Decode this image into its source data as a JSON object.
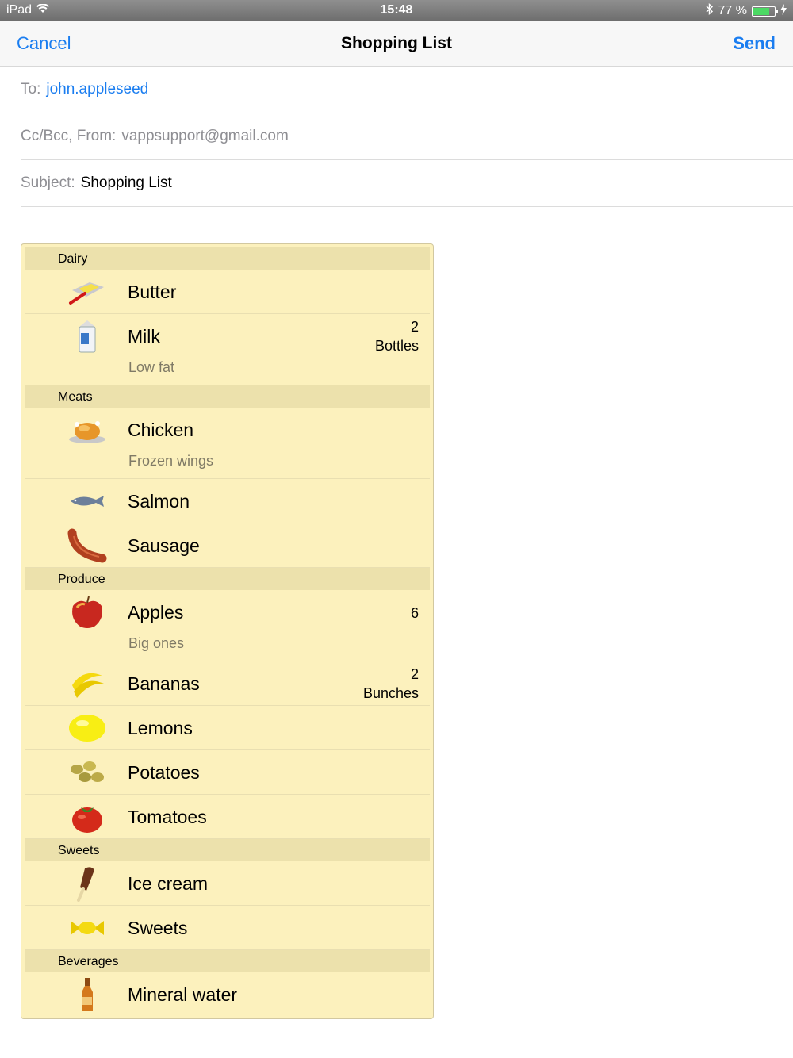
{
  "status_bar": {
    "device": "iPad",
    "time": "15:48",
    "battery": "77 %",
    "battery_level": 0.77
  },
  "nav": {
    "cancel": "Cancel",
    "title": "Shopping List",
    "send": "Send"
  },
  "fields": {
    "to_label": "To:",
    "to_value": "john.appleseed",
    "ccbcc_label": "Cc/Bcc, From:",
    "from_value": "vappsupport@gmail.com",
    "subject_label": "Subject:",
    "subject_value": "Shopping List"
  },
  "sections": [
    {
      "title": "Dairy",
      "items": [
        {
          "name": "Butter",
          "note": "",
          "qty": "",
          "unit": "",
          "icon": "butter-icon"
        },
        {
          "name": "Milk",
          "note": "Low fat",
          "qty": "2",
          "unit": "Bottles",
          "icon": "milk-icon"
        }
      ]
    },
    {
      "title": "Meats",
      "items": [
        {
          "name": "Chicken",
          "note": "Frozen wings",
          "qty": "",
          "unit": "",
          "icon": "chicken-icon"
        },
        {
          "name": "Salmon",
          "note": "",
          "qty": "",
          "unit": "",
          "icon": "fish-icon"
        },
        {
          "name": "Sausage",
          "note": "",
          "qty": "",
          "unit": "",
          "icon": "sausage-icon"
        }
      ]
    },
    {
      "title": "Produce",
      "items": [
        {
          "name": "Apples",
          "note": "Big ones",
          "qty": "6",
          "unit": "",
          "icon": "apple-icon"
        },
        {
          "name": "Bananas",
          "note": "",
          "qty": "2",
          "unit": "Bunches",
          "icon": "banana-icon"
        },
        {
          "name": "Lemons",
          "note": "",
          "qty": "",
          "unit": "",
          "icon": "lemon-icon"
        },
        {
          "name": "Potatoes",
          "note": "",
          "qty": "",
          "unit": "",
          "icon": "potato-icon"
        },
        {
          "name": "Tomatoes",
          "note": "",
          "qty": "",
          "unit": "",
          "icon": "tomato-icon"
        }
      ]
    },
    {
      "title": "Sweets",
      "items": [
        {
          "name": "Ice cream",
          "note": "",
          "qty": "",
          "unit": "",
          "icon": "ice-cream-icon"
        },
        {
          "name": "Sweets",
          "note": "",
          "qty": "",
          "unit": "",
          "icon": "candy-icon"
        }
      ]
    },
    {
      "title": "Beverages",
      "items": [
        {
          "name": "Mineral water",
          "note": "",
          "qty": "",
          "unit": "",
          "icon": "bottle-icon"
        }
      ]
    }
  ]
}
